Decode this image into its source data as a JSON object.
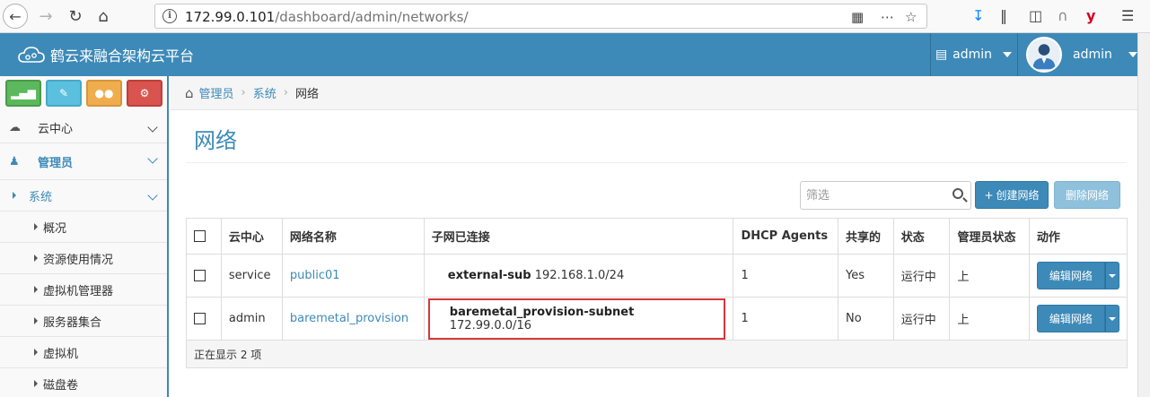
{
  "browser": {
    "url_host": "172.99.0.101",
    "url_path": "/dashboard/admin/networks/"
  },
  "header": {
    "brand_title": "鹤云来融合架构云平台",
    "project_menu_label": "admin",
    "user_menu_label": "admin",
    "brand_color": "#3d8ab8"
  },
  "sidebar": {
    "shortcut_icons": [
      "signal-icon",
      "pencil-icon",
      "users-icon",
      "gears-icon"
    ],
    "items": [
      {
        "label": "云中心",
        "level": 1
      },
      {
        "label": "管理员",
        "level": 1,
        "active": true
      },
      {
        "label": "系统",
        "level": 2
      },
      {
        "label": "概况",
        "level": 3
      },
      {
        "label": "资源使用情况",
        "level": 3
      },
      {
        "label": "虚拟机管理器",
        "level": 3
      },
      {
        "label": "服务器集合",
        "level": 3
      },
      {
        "label": "虚拟机",
        "level": 3
      },
      {
        "label": "磁盘卷",
        "level": 3
      }
    ]
  },
  "breadcrumb": [
    "管理员",
    "系统",
    "网络"
  ],
  "main": {
    "title": "网络",
    "filter_placeholder": "筛选",
    "create_button": "创建网络",
    "delete_button": "删除网络",
    "table": {
      "columns": [
        "云中心",
        "网络名称",
        "子网已连接",
        "DHCP Agents",
        "共享的",
        "状态",
        "管理员状态",
        "动作"
      ],
      "rows": [
        {
          "project": "service",
          "name": "public01",
          "subnet_name": "external-sub",
          "subnet_cidr": "192.168.1.0/24",
          "dhcp_agents": "1",
          "shared": "Yes",
          "status": "运行中",
          "admin_state": "上",
          "action": "编辑网络"
        },
        {
          "project": "admin",
          "name": "baremetal_provision",
          "subnet_name": "baremetal_provision-subnet",
          "subnet_cidr": "172.99.0.0/16",
          "dhcp_agents": "1",
          "shared": "No",
          "status": "运行中",
          "admin_state": "上",
          "action": "编辑网络",
          "highlighted": true
        }
      ],
      "footer": "正在显示 2 项"
    }
  }
}
